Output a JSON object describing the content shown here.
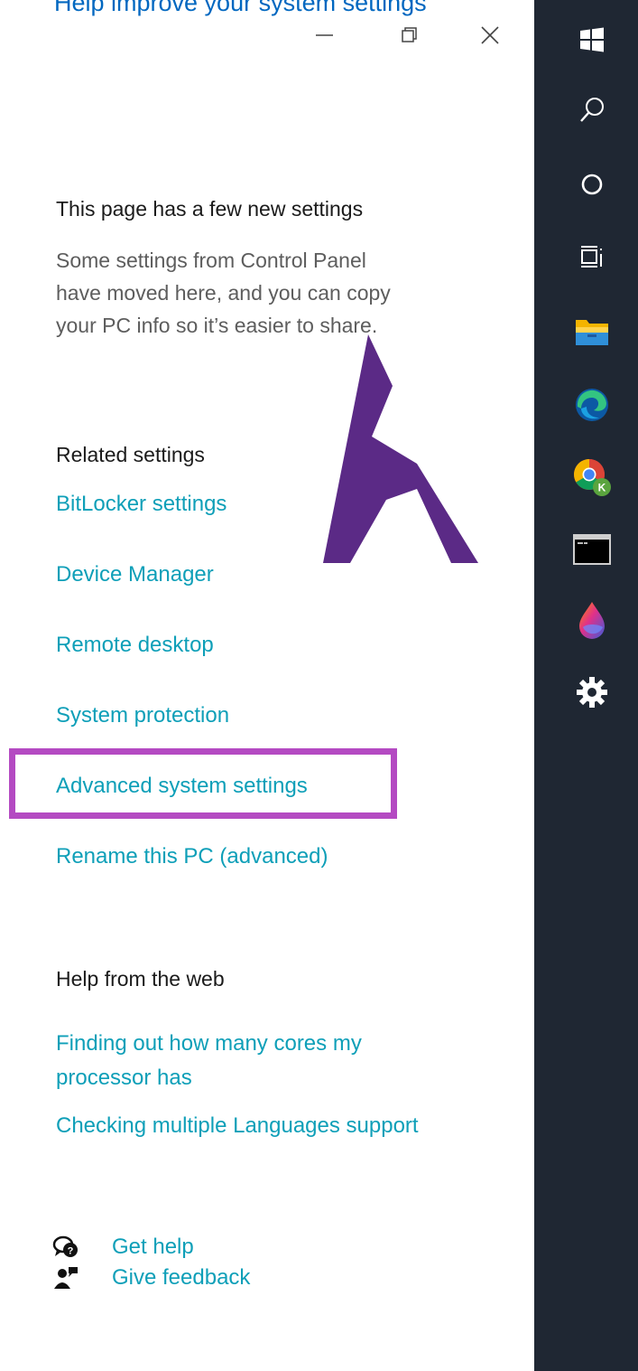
{
  "header": {
    "cut_link_text": "Help improve your system settings",
    "window_controls": {
      "minimize": "minimize",
      "maximize": "restore",
      "close": "close"
    }
  },
  "new_settings": {
    "title": "This page has a few new settings",
    "description_lines": [
      "Some settings from Control Panel",
      "have moved here, and you can copy",
      "your PC info so it’s easier to share."
    ]
  },
  "related_settings": {
    "title": "Related settings",
    "links": [
      "BitLocker settings",
      "Device Manager",
      "Remote desktop",
      "System protection",
      "Advanced system settings",
      "Rename this PC (advanced)"
    ]
  },
  "help_web": {
    "title": "Help from the web",
    "link1_lines": [
      "Finding out how many cores my",
      "processor has"
    ],
    "link2": "Checking multiple Languages support"
  },
  "footer": {
    "get_help": "Get help",
    "give_feedback": "Give feedback"
  },
  "taskbar": {
    "icons": [
      "windows-start-icon",
      "search-icon",
      "cortana-icon",
      "task-view-icon",
      "file-explorer-icon",
      "edge-icon",
      "chrome-icon",
      "terminal-icon",
      "paint-icon",
      "settings-icon"
    ],
    "chrome_badge": "K"
  },
  "colors": {
    "link": "#0e9fb8",
    "highlight": "#b44ac2",
    "logo": "#5b2a86",
    "taskbar_bg": "#1f2733"
  }
}
